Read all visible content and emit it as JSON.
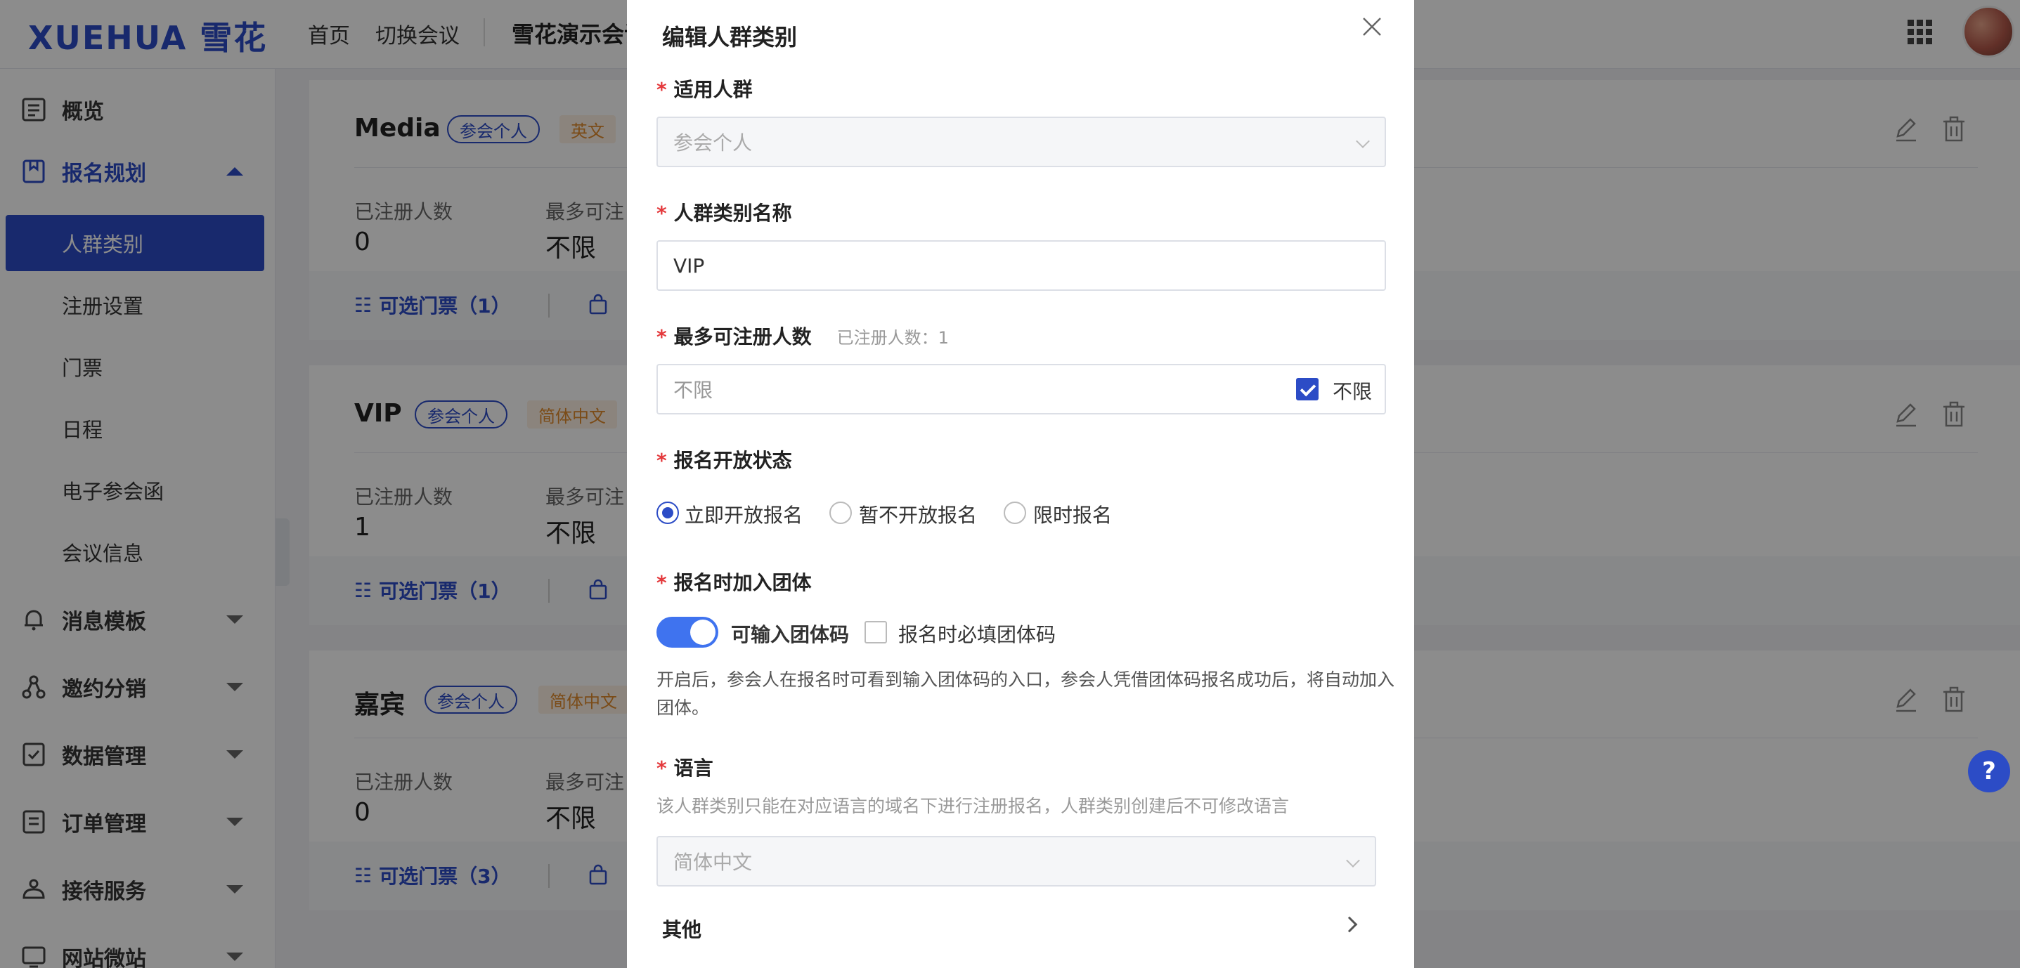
{
  "header": {
    "logo": "XUEHUA 雪花",
    "nav": [
      "首页",
      "切换会议"
    ],
    "conference": "雪花演示会议"
  },
  "sidebar": {
    "items": [
      {
        "label": "概览",
        "icon": "overview-icon"
      },
      {
        "label": "报名规划",
        "icon": "registration-plan-icon",
        "expanded": true
      },
      {
        "label": "消息模板",
        "icon": "bell-icon"
      },
      {
        "label": "邀约分销",
        "icon": "share-icon"
      },
      {
        "label": "数据管理",
        "icon": "data-icon"
      },
      {
        "label": "订单管理",
        "icon": "order-icon"
      },
      {
        "label": "接待服务",
        "icon": "reception-icon"
      },
      {
        "label": "网站微站",
        "icon": "website-icon"
      }
    ],
    "sub_items": [
      "人群类别",
      "注册设置",
      "门票",
      "日程",
      "电子参会函",
      "会议信息"
    ],
    "active_sub": "人群类别"
  },
  "cards": [
    {
      "name": "Media",
      "tag": "参会个人",
      "lang": "英文",
      "registered_label": "已注册人数",
      "registered": "0",
      "max_label": "最多可注",
      "max": "不限",
      "tickets": "可选门票（1）",
      "more": "可"
    },
    {
      "name": "VIP",
      "tag": "参会个人",
      "lang": "简体中文",
      "registered_label": "已注册人数",
      "registered": "1",
      "max_label": "最多可注",
      "max": "不限",
      "tickets": "可选门票（1）",
      "more": "可"
    },
    {
      "name": "嘉宾",
      "tag": "参会个人",
      "lang": "简体中文",
      "registered_label": "已注册人数",
      "registered": "0",
      "max_label": "最多可注",
      "max": "不限",
      "tickets": "可选门票（3）",
      "more": "可"
    }
  ],
  "help": "?",
  "modal": {
    "title": "编辑人群类别",
    "audience": {
      "label": "适用人群",
      "value": "参会个人"
    },
    "category_name": {
      "label": "人群类别名称",
      "value": "VIP"
    },
    "max_registrants": {
      "label": "最多可注册人数",
      "hint": "已注册人数：1",
      "value": "不限",
      "unlimited_label": "不限",
      "unlimited": true
    },
    "open_status": {
      "label": "报名开放状态",
      "options": [
        "立即开放报名",
        "暂不开放报名",
        "限时报名"
      ],
      "selected": 0
    },
    "group": {
      "label": "报名时加入团体",
      "switch_label": "可输入团体码",
      "switch_on": true,
      "required_label": "报名时必填团体码",
      "required": false,
      "description": "开启后，参会人在报名时可看到输入团体码的入口，参会人凭借团体码报名成功后，将自动加入团体。"
    },
    "language": {
      "label": "语言",
      "description": "该人群类别只能在对应语言的域名下进行注册报名，人群类别创建后不可修改语言",
      "value": "简体中文"
    },
    "other": "其他"
  },
  "colors": {
    "accent": "#2c4cc6",
    "required": "#e4393c",
    "tag_orange": "#e08a2c"
  }
}
